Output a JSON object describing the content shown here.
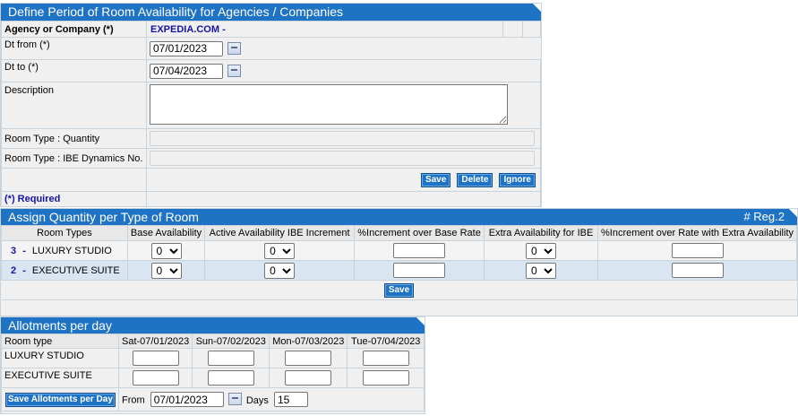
{
  "define": {
    "title": "Define Period of Room Availability for Agencies / Companies",
    "agency_label": "Agency or Company (*)",
    "agency_value": "EXPEDIA.COM -",
    "dt_from_label": "Dt from (*)",
    "dt_from_value": "07/01/2023",
    "dt_to_label": "Dt to (*)",
    "dt_to_value": "07/04/2023",
    "description_label": "Description",
    "description_value": "",
    "room_qty_label": "Room Type : Quantity",
    "room_ibe_label": "Room Type : IBE Dynamics No.",
    "save_label": "Save",
    "delete_label": "Delete",
    "ignore_label": "Ignore",
    "required_label": "(*) Required"
  },
  "assign": {
    "title": "Assign Quantity per Type of Room",
    "reg": "# Reg.2",
    "headers": [
      "Room Types",
      "Base Availability",
      "Active Availability IBE Increment",
      "%Increment over Base Rate",
      "Extra Availability for IBE",
      "%Increment over Rate with Extra Availability"
    ],
    "rows": [
      {
        "id": "3",
        "sep": "-",
        "name": "LUXURY STUDIO",
        "base": "0",
        "active": "0",
        "extra": "0"
      },
      {
        "id": "2",
        "sep": "-",
        "name": "EXECUTIVE SUITE",
        "base": "0",
        "active": "0",
        "extra": "0"
      }
    ],
    "save_label": "Save"
  },
  "allot": {
    "title": "Allotments per day",
    "room_type_header": "Room type",
    "days": [
      "Sat-07/01/2023",
      "Sun-07/02/2023",
      "Mon-07/03/2023",
      "Tue-07/04/2023"
    ],
    "rows": [
      "LUXURY STUDIO",
      "EXECUTIVE SUITE"
    ],
    "save_label": "Save Allotments per Day",
    "from_label": "From",
    "from_value": "07/01/2023",
    "days_label": "Days",
    "days_value": "15"
  }
}
